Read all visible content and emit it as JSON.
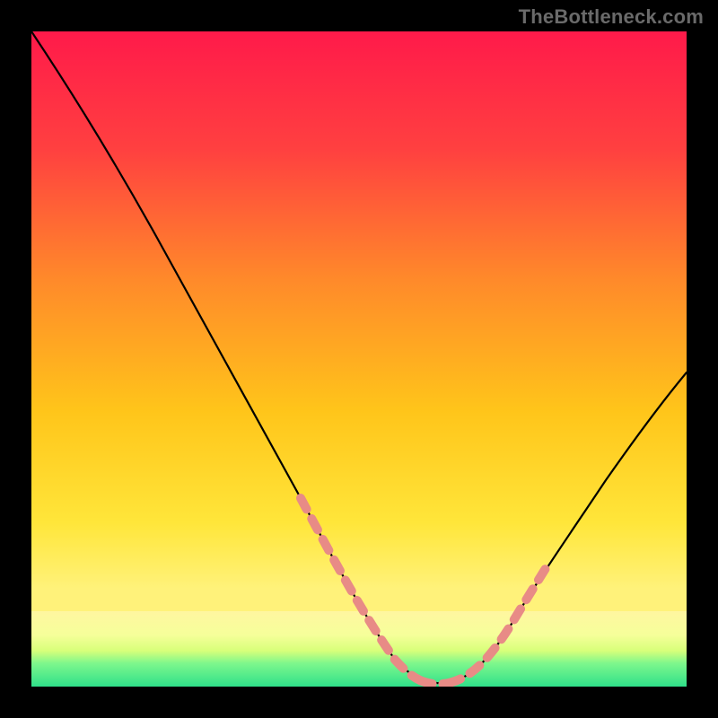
{
  "watermark": "TheBottleneck.com",
  "colors": {
    "background_black": "#000000",
    "gradient_top": "#ff1a4a",
    "gradient_mid1": "#ff6a2a",
    "gradient_mid2": "#ffd21a",
    "gradient_mid3": "#fff05a",
    "gradient_bottom": "#2fe08a",
    "curve_line": "#000000",
    "dash_color": "#e88b86"
  },
  "chart_data": {
    "type": "line",
    "title": "",
    "xlabel": "",
    "ylabel": "",
    "xlim": [
      0,
      100
    ],
    "ylim": [
      0,
      100
    ],
    "x": [
      0,
      3,
      8,
      14,
      20,
      26,
      32,
      38,
      44,
      48,
      52,
      56,
      60,
      64,
      68,
      72,
      76,
      80,
      85,
      90,
      95,
      100
    ],
    "y": [
      100,
      96,
      88,
      78,
      68,
      58,
      48,
      38,
      28,
      19,
      11,
      5,
      2,
      1,
      1,
      4,
      10,
      18,
      28,
      37,
      44,
      50
    ],
    "dash_highlight_x_range": [
      38,
      76
    ],
    "annotations": []
  }
}
